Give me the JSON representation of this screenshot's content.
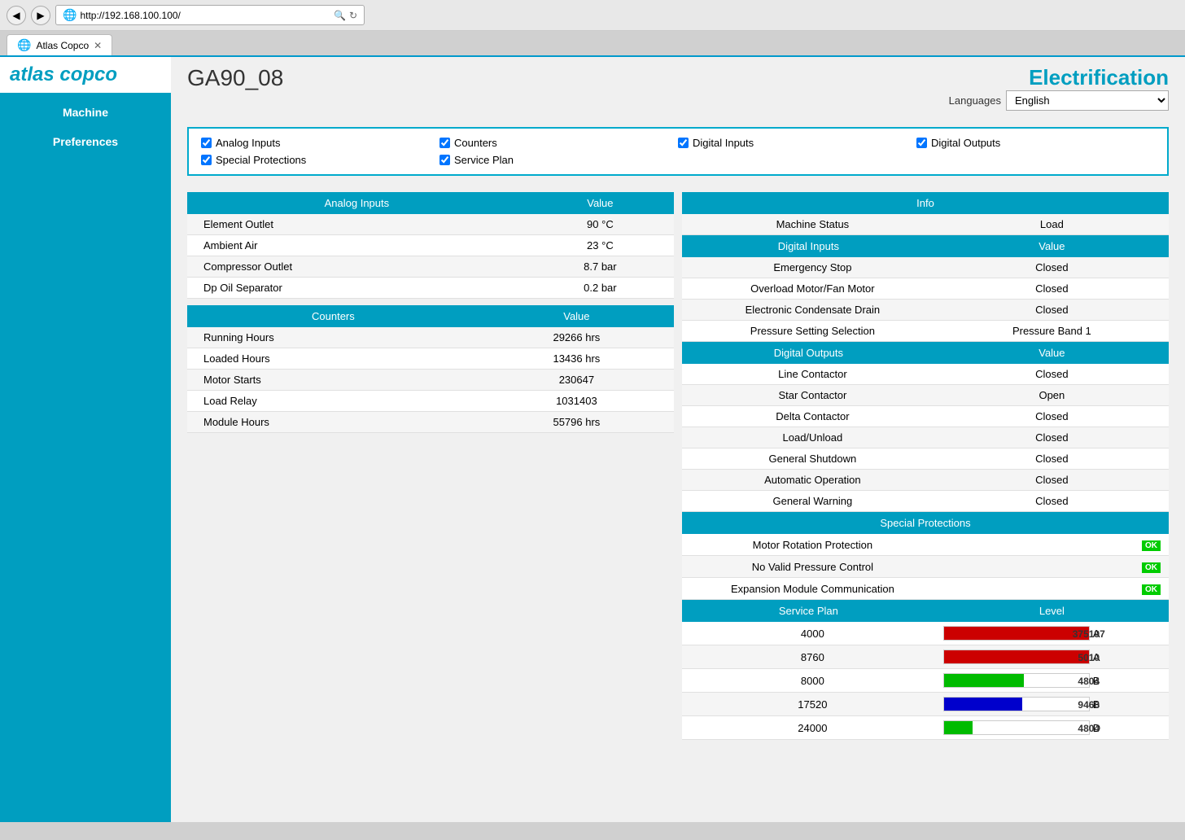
{
  "browser": {
    "url": "http://192.168.100.100/",
    "tab_title": "Atlas Copco",
    "back_btn": "◀",
    "forward_btn": "▶",
    "refresh_icon": "↻",
    "search_icon": "🔍"
  },
  "header": {
    "title": "GA90_08",
    "electrification": "Electrification",
    "languages_label": "Languages",
    "language_selected": "English"
  },
  "sidebar": {
    "machine_label": "Machine",
    "preferences_label": "Preferences",
    "logo_text": "Atlas Copco"
  },
  "checkboxes": [
    {
      "label": "Analog Inputs",
      "checked": true
    },
    {
      "label": "Counters",
      "checked": true
    },
    {
      "label": "Digital Inputs",
      "checked": true
    },
    {
      "label": "Digital Outputs",
      "checked": true
    },
    {
      "label": "Special Protections",
      "checked": true
    },
    {
      "label": "Service Plan",
      "checked": true
    }
  ],
  "analog_inputs": {
    "header": "Analog Inputs",
    "value_header": "Value",
    "rows": [
      {
        "label": "Element Outlet",
        "value": "90 °C"
      },
      {
        "label": "Ambient Air",
        "value": "23 °C"
      },
      {
        "label": "Compressor Outlet",
        "value": "8.7 bar"
      },
      {
        "label": "Dp Oil Separator",
        "value": "0.2 bar"
      }
    ]
  },
  "counters": {
    "header": "Counters",
    "value_header": "Value",
    "rows": [
      {
        "label": "Running Hours",
        "value": "29266 hrs"
      },
      {
        "label": "Loaded Hours",
        "value": "13436 hrs"
      },
      {
        "label": "Motor Starts",
        "value": "230647"
      },
      {
        "label": "Load Relay",
        "value": "1031403"
      },
      {
        "label": "Module Hours",
        "value": "55796 hrs"
      }
    ]
  },
  "info": {
    "header": "Info",
    "machine_status_label": "Machine Status",
    "machine_status_value": "Load"
  },
  "digital_inputs": {
    "header": "Digital Inputs",
    "value_header": "Value",
    "rows": [
      {
        "label": "Emergency Stop",
        "value": "Closed"
      },
      {
        "label": "Overload Motor/Fan Motor",
        "value": "Closed"
      },
      {
        "label": "Electronic Condensate Drain",
        "value": "Closed"
      },
      {
        "label": "Pressure Setting Selection",
        "value": "Pressure Band 1"
      }
    ]
  },
  "digital_outputs": {
    "header": "Digital Outputs",
    "value_header": "Value",
    "rows": [
      {
        "label": "Line Contactor",
        "value": "Closed"
      },
      {
        "label": "Star Contactor",
        "value": "Open"
      },
      {
        "label": "Delta Contactor",
        "value": "Closed"
      },
      {
        "label": "Load/Unload",
        "value": "Closed"
      },
      {
        "label": "General Shutdown",
        "value": "Closed"
      },
      {
        "label": "Automatic Operation",
        "value": "Closed"
      },
      {
        "label": "General Warning",
        "value": "Closed"
      }
    ]
  },
  "special_protections": {
    "header": "Special Protections",
    "rows": [
      {
        "label": "Motor Rotation Protection",
        "status": "OK"
      },
      {
        "label": "No Valid Pressure Control",
        "status": "OK"
      },
      {
        "label": "Expansion Module Communication",
        "status": "OK"
      }
    ]
  },
  "service_plan": {
    "header": "Service Plan",
    "level_header": "Level",
    "rows": [
      {
        "threshold": "4000",
        "value": 375197,
        "bar_pct": 100,
        "bar_color": "#cc0000",
        "level": "A"
      },
      {
        "threshold": "8760",
        "value": 5010,
        "bar_pct": 100,
        "bar_color": "#cc0000",
        "level": "A"
      },
      {
        "threshold": "8000",
        "value": 4804,
        "bar_pct": 60,
        "bar_color": "#00cc00",
        "level": "B"
      },
      {
        "threshold": "17520",
        "value": 9460,
        "bar_pct": 54,
        "bar_color": "#0000cc",
        "level": "B"
      },
      {
        "threshold": "24000",
        "value": 4804,
        "bar_pct": 20,
        "bar_color": "#00cc00",
        "level": "D"
      }
    ]
  }
}
